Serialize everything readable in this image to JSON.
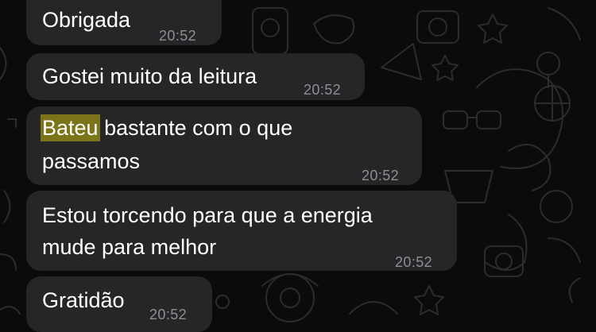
{
  "messages": [
    {
      "text": "Obrigada",
      "time": "20:52"
    },
    {
      "text": "Gostei muito da leitura",
      "time": "20:52"
    },
    {
      "highlight": "Bateu",
      "text_after_highlight": " bastante com o que",
      "line2": "passamos",
      "time": "20:52"
    },
    {
      "line1": "Estou torcendo para que a energia",
      "line2": "mude para melhor",
      "time": "20:52"
    },
    {
      "text": "Gratidão",
      "time": "20:52"
    }
  ],
  "colors": {
    "background": "#0b0b0b",
    "bubble": "#262628",
    "text": "#ffffff",
    "timestamp": "#8e8e93",
    "search_highlight": "#7b7419"
  }
}
